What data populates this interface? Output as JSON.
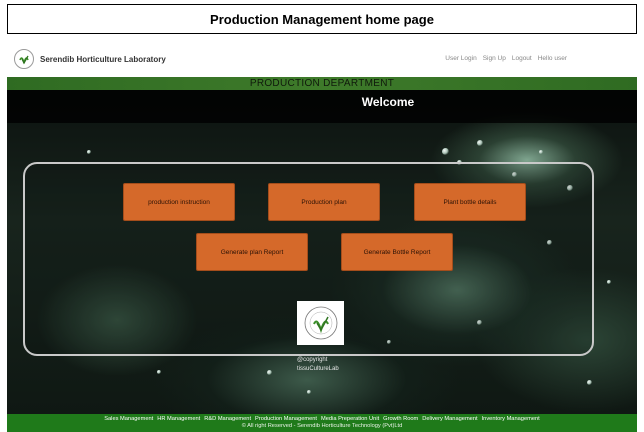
{
  "caption": "Production Management home page",
  "header": {
    "brand": "Serendib Horticulture Laboratory",
    "links": [
      "User Login",
      "Sign Up",
      "Logout",
      "Hello user"
    ]
  },
  "department_title": "PRODUCTION DEPARTMENT",
  "welcome": "Welcome",
  "actions": [
    "production instruction",
    "Production plan",
    "Plant bottle details",
    "Generate plan Report",
    "Generate Bottle Report"
  ],
  "copyright_short": [
    "@copyright",
    "tissuCultureLab"
  ],
  "footer": {
    "nav": [
      "Sales Management",
      "HR Management",
      "R&D Management",
      "Production Management",
      "Media Preperation Unit",
      "Growth Room",
      "Delivery Management",
      "Inventory Management"
    ],
    "copyright": "© All right Reserved - Serendib Horticulture Technology (Pvt)Ltd"
  },
  "colors": {
    "accent_button": "#d5692a",
    "department_bar": "#3e7a2a",
    "footer": "#1f7a1a"
  }
}
